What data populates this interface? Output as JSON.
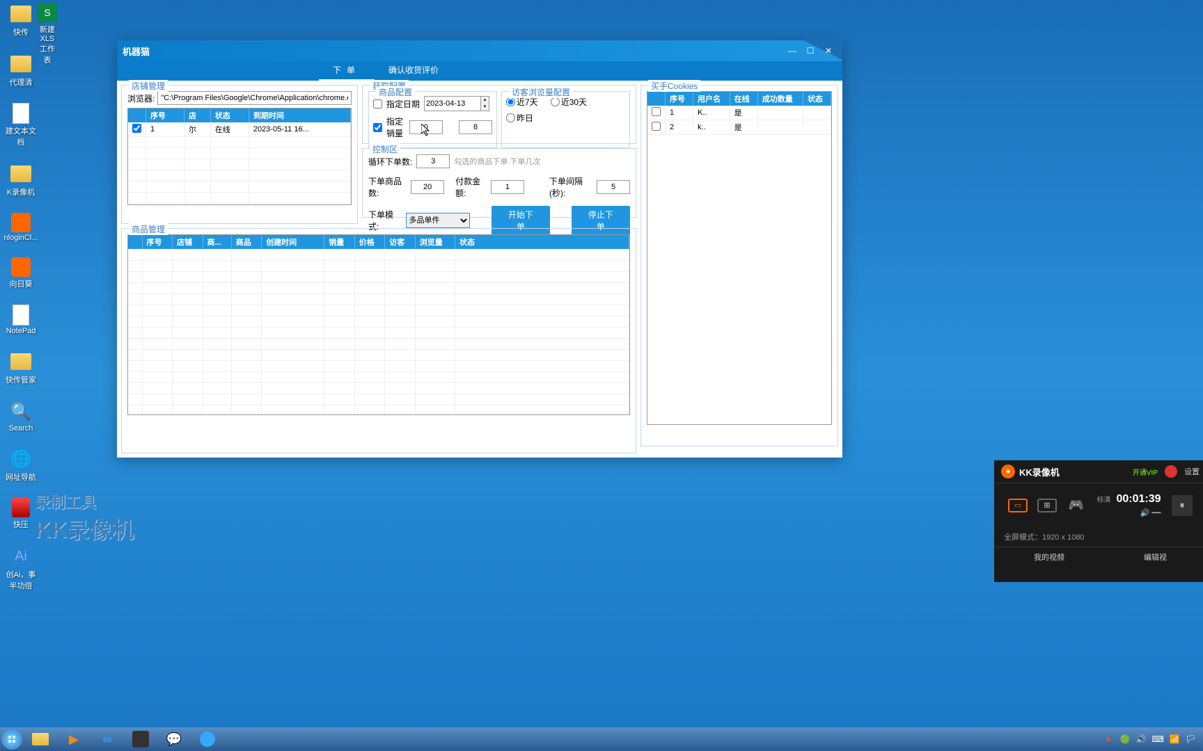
{
  "desktop": {
    "icons": [
      {
        "label": "快传",
        "type": "folder"
      },
      {
        "label": "新建 XLS 工作表",
        "type": "xls"
      },
      {
        "label": "代理清",
        "type": "folder"
      },
      {
        "label": "建文本文档",
        "type": "txt"
      },
      {
        "label": "K录像机",
        "type": "folder"
      },
      {
        "label": "nloginCl...",
        "type": "app-orange"
      },
      {
        "label": "向日葵",
        "type": "app-orange"
      },
      {
        "label": "NotePad",
        "type": "txt"
      },
      {
        "label": "快传管家",
        "type": "folder"
      },
      {
        "label": "Search",
        "type": "app-blue"
      },
      {
        "label": "网址导航",
        "type": "app-blue"
      },
      {
        "label": "快压",
        "type": "app-red"
      },
      {
        "label": "创Ai，事半功倍",
        "type": "ai"
      }
    ]
  },
  "app": {
    "title": "机器猫",
    "tabs": {
      "t1": "下单",
      "t2": "确认收货评价"
    },
    "store_mgmt": {
      "title": "店铺管理",
      "browser_label": "浏览器:",
      "browser_path": "\"C:\\Program Files\\Google\\Chrome\\Application\\chrome.exe\" http",
      "cols": {
        "c1": "序号",
        "c2": "店",
        "c3": "状态",
        "c4": "到期时间"
      },
      "rows": [
        {
          "seq": "1",
          "shop": "尔",
          "status": "在线",
          "expire": "2023-05-11 16..."
        }
      ]
    },
    "config_row": {
      "get_config": "获取配置",
      "product_config": {
        "title": "商品配置",
        "date_chk": "指定日期",
        "date_val": "2023-04-13",
        "sales_chk": "指定销量",
        "sales_from": "0",
        "sales_to": "8"
      },
      "visitor_config": {
        "title": "访客浏览量配置",
        "opt7": "近7天",
        "opt30": "近30天",
        "optYesterday": "昨日"
      }
    },
    "control": {
      "title": "控制区",
      "loop_label": "循环下单数:",
      "loop_val": "3",
      "loop_hint": "勾选的商品下单 下单几次",
      "count_label": "下单商品数:",
      "count_val": "20",
      "pay_label": "付款金额:",
      "pay_val": "1",
      "interval_label": "下单间隔(秒):",
      "interval_val": "5",
      "mode_label": "下单模式:",
      "mode_val": "多品单件",
      "btn_start": "开始下单",
      "btn_stop": "停止下单"
    },
    "product_mgmt": {
      "title": "商品管理",
      "cols": {
        "c1": "序号",
        "c2": "店铺",
        "c3": "商...",
        "c4": "商品",
        "c5": "创建时间",
        "c6": "销量",
        "c7": "价格",
        "c8": "访客",
        "c9": "浏览量",
        "c10": "状态"
      }
    },
    "cookies": {
      "title": "买手Cookies",
      "cols": {
        "c1": "序号",
        "c2": "用户名",
        "c3": "在线",
        "c4": "成功数量",
        "c5": "状态"
      },
      "rows": [
        {
          "seq": "1",
          "user": "K..",
          "online": "是"
        },
        {
          "seq": "2",
          "user": "k..",
          "online": "是"
        }
      ]
    }
  },
  "watermark": {
    "line1": "录制工具",
    "line2": "KK录像机"
  },
  "recorder": {
    "title": "KK录像机",
    "vip": "开通VIP",
    "settings": "设置",
    "quality": "标清",
    "time": "00:01:39",
    "fullscreen": "全屏模式：1920 x 1080",
    "my_video": "我的视频",
    "edit_video": "编辑视"
  },
  "taskbar": {
    "tray": [
      "🔺",
      "🟢",
      "🔊",
      "⌨",
      "📶",
      "🏳"
    ]
  }
}
